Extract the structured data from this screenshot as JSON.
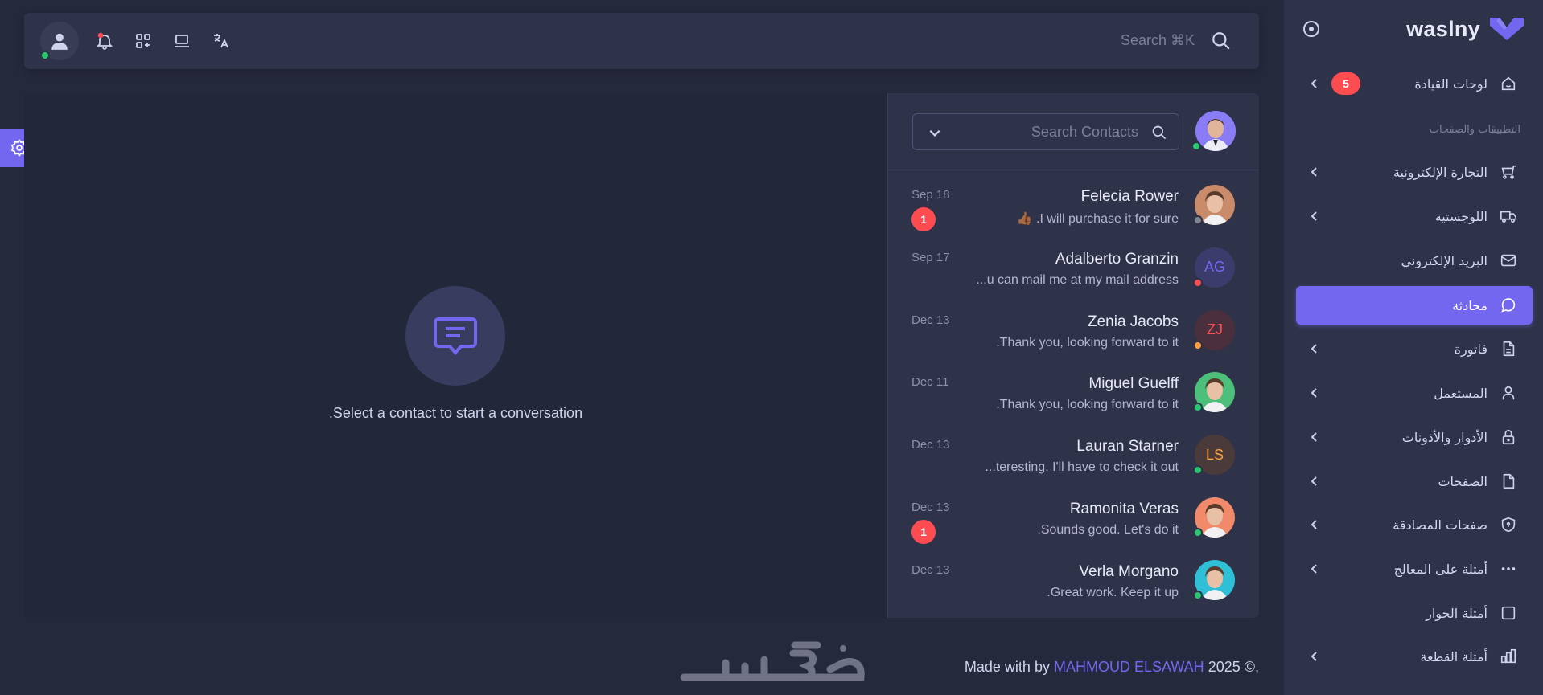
{
  "brand": {
    "name": "waslny",
    "color": "#7367f0"
  },
  "navbar": {
    "search_label": "Search ⌘K",
    "icons": [
      "user-avatar",
      "bell-icon",
      "apps-icon",
      "laptop-icon",
      "translate-icon"
    ]
  },
  "sidebar": {
    "section_title": "التطبيقات والصفحات",
    "dashboards": {
      "label": "لوحات القيادة",
      "badge": "5"
    },
    "items": [
      {
        "label": "التجارة الإلكترونية",
        "icon": "cart-icon",
        "has_chevron": true
      },
      {
        "label": "اللوجستية",
        "icon": "truck-icon",
        "has_chevron": true
      },
      {
        "label": "البريد الإلكتروني",
        "icon": "mail-icon",
        "has_chevron": false
      },
      {
        "label": "محادثة",
        "icon": "chat-icon",
        "has_chevron": false,
        "active": true
      },
      {
        "label": "فاتورة",
        "icon": "file-invoice-icon",
        "has_chevron": true
      },
      {
        "label": "المستعمل",
        "icon": "user-icon",
        "has_chevron": true
      },
      {
        "label": "الأدوار والأذونات",
        "icon": "lock-icon",
        "has_chevron": true
      },
      {
        "label": "الصفحات",
        "icon": "file-icon",
        "has_chevron": true
      },
      {
        "label": "صفحات المصادقة",
        "icon": "shield-icon",
        "has_chevron": true
      },
      {
        "label": "أمثلة على المعالج",
        "icon": "dots-icon",
        "has_chevron": true
      },
      {
        "label": "أمثلة الحوار",
        "icon": "square-icon",
        "has_chevron": false
      },
      {
        "label": "أمثلة القطعة",
        "icon": "chart-bar-icon",
        "has_chevron": true
      }
    ]
  },
  "chat": {
    "empty_message": ".Select a contact to start a conversation",
    "search_placeholder": "Search Contacts",
    "contacts": [
      {
        "name": "Felecia Rower",
        "message": "👍🏾 .I will purchase it for sure",
        "date": "Sep 18",
        "unread": "1",
        "status": "offline",
        "initials": "",
        "avatar_color": "#c98b6a"
      },
      {
        "name": "Adalberto Granzin",
        "message": "...u can mail me at my mail address",
        "date": "Sep 17",
        "unread": "",
        "status": "busy",
        "initials": "AG",
        "avatar_color": "#3b3c6b",
        "initials_color": "#7367f0"
      },
      {
        "name": "Zenia Jacobs",
        "message": ".Thank you, looking forward to it",
        "date": "Dec 13",
        "unread": "",
        "status": "away",
        "initials": "ZJ",
        "avatar_color": "#4a2f3d",
        "initials_color": "#ff4c51"
      },
      {
        "name": "Miguel Guelff",
        "message": ".Thank you, looking forward to it",
        "date": "Dec 11",
        "unread": "",
        "status": "online",
        "initials": "",
        "avatar_color": "#4cc07a"
      },
      {
        "name": "Lauran Starner",
        "message": "...teresting. I'll have to check it out",
        "date": "Dec 13",
        "unread": "",
        "status": "online",
        "initials": "LS",
        "avatar_color": "#4b3a3a",
        "initials_color": "#ff9f43"
      },
      {
        "name": "Ramonita Veras",
        "message": ".Sounds good. Let's do it",
        "date": "Dec 13",
        "unread": "1",
        "status": "online",
        "initials": "",
        "avatar_color": "#f08a6b"
      },
      {
        "name": "Verla Morgano",
        "message": ".Great work. Keep it up",
        "date": "Dec 13",
        "unread": "",
        "status": "online",
        "initials": "",
        "avatar_color": "#2fc0d8"
      }
    ]
  },
  "footer": {
    "prefix": "Made with by",
    "author": "MAHMOUD ELSAWAH",
    "suffix": "2025 ©,"
  },
  "colors": {
    "primary": "#7367f0",
    "online": "#28c76f",
    "busy": "#ff4c51",
    "away": "#ff9f43",
    "offline": "#808390"
  }
}
